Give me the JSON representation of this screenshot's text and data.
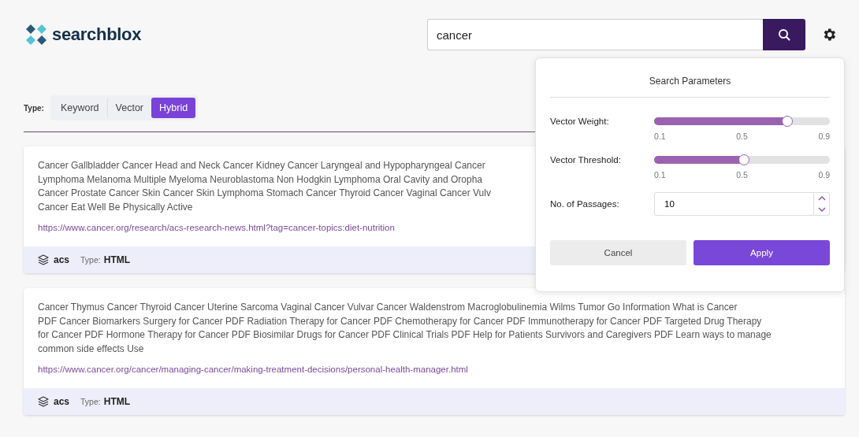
{
  "logo": {
    "name": "searchblox"
  },
  "search": {
    "value": "cancer"
  },
  "type_filter": {
    "label": "Type:",
    "options": [
      {
        "label": "Keyword",
        "selected": false
      },
      {
        "label": "Vector",
        "selected": false
      },
      {
        "label": "Hybrid",
        "selected": true
      }
    ]
  },
  "results": [
    {
      "snippet_lines": [
        "Cancer Gallbladder Cancer Head and Neck Cancer Kidney Cancer Laryngeal and Hypopharyngeal Cancer",
        "Lymphoma Melanoma Multiple Myeloma Neuroblastoma Non Hodgkin Lymphoma Oral Cavity and Oropha",
        "Cancer Prostate Cancer Skin Cancer Skin Lymphoma Stomach Cancer Thyroid Cancer Vaginal Cancer Vulv",
        "Cancer Eat Well Be Physically Active"
      ],
      "url": "https://www.cancer.org/research/acs-research-news.html?tag=cancer-topics:diet-nutrition",
      "collection": "acs",
      "type_label": "Type:",
      "type": "HTML"
    },
    {
      "snippet_lines": [
        "Cancer Thymus Cancer Thyroid Cancer Uterine Sarcoma Vaginal Cancer Vulvar Cancer Waldenstrom Macroglobulinemia Wilms Tumor Go Information What is Cancer",
        "PDF Cancer Biomarkers Surgery for Cancer PDF Radiation Therapy for Cancer PDF Chemotherapy for Cancer PDF Immunotherapy for Cancer PDF Targeted Drug Therapy",
        "for Cancer PDF Hormone Therapy for Cancer PDF Biosimilar Drugs for Cancer PDF Clinical Trials PDF Help for Patients Survivors and Caregivers PDF Learn ways to manage",
        "common side effects Use"
      ],
      "url": "https://www.cancer.org/cancer/managing-cancer/making-treatment-decisions/personal-health-manager.html",
      "collection": "acs",
      "type_label": "Type:",
      "type": "HTML"
    }
  ],
  "search_parameters": {
    "title": "Search Parameters",
    "sliders": [
      {
        "label": "Vector Weight:",
        "level": 0.76,
        "ticks": [
          "0.1",
          "0.5",
          "0.9"
        ]
      },
      {
        "label": "Vector Threshold:",
        "level": 0.51,
        "ticks": [
          "0.1",
          "0.5",
          "0.9"
        ]
      }
    ],
    "passages": {
      "label": "No. of Passages:",
      "value": "10"
    },
    "buttons": [
      {
        "label": "Cancel",
        "kind": "secondary"
      },
      {
        "label": "Apply",
        "kind": "primary"
      }
    ]
  }
}
